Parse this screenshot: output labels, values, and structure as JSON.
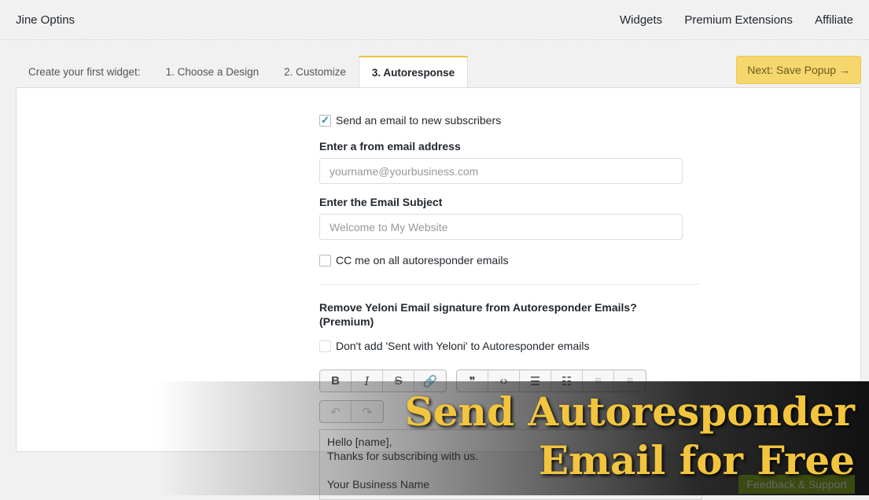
{
  "header": {
    "brand": "Jine Optins",
    "nav": [
      "Widgets",
      "Premium Extensions",
      "Affiliate"
    ]
  },
  "tabs": {
    "intro": "Create your first widget:",
    "items": [
      "1. Choose a Design",
      "2. Customize",
      "3. Autoresponse"
    ],
    "next": "Next: Save Popup →"
  },
  "form": {
    "send_email": {
      "label": "Send an email to new subscribers",
      "checked": true
    },
    "from_label": "Enter a from email address",
    "from_placeholder": "yourname@yourbusiness.com",
    "subject_label": "Enter the Email Subject",
    "subject_placeholder": "Welcome to My Website",
    "cc": {
      "label": "CC me on all autoresponder emails",
      "checked": false
    },
    "sig_label": "Remove Yeloni Email signature from Autoresponder Emails? (Premium)",
    "sig_cb": {
      "label": "Don't add 'Sent with Yeloni' to Autoresponder emails",
      "checked": false
    },
    "toolbar": [
      "B",
      "I",
      "S",
      "🔗",
      "❞",
      "‹›",
      "☰",
      "☷",
      "≡",
      "≡"
    ],
    "undo": [
      "↶",
      "↷"
    ],
    "body": [
      "Hello [name],",
      "Thanks for subscribing with us.",
      "",
      "Your Business Name"
    ]
  },
  "banner": {
    "line1": "Send Autoresponder",
    "line2": "Email for Free"
  },
  "feedback": "Feedback & Support"
}
